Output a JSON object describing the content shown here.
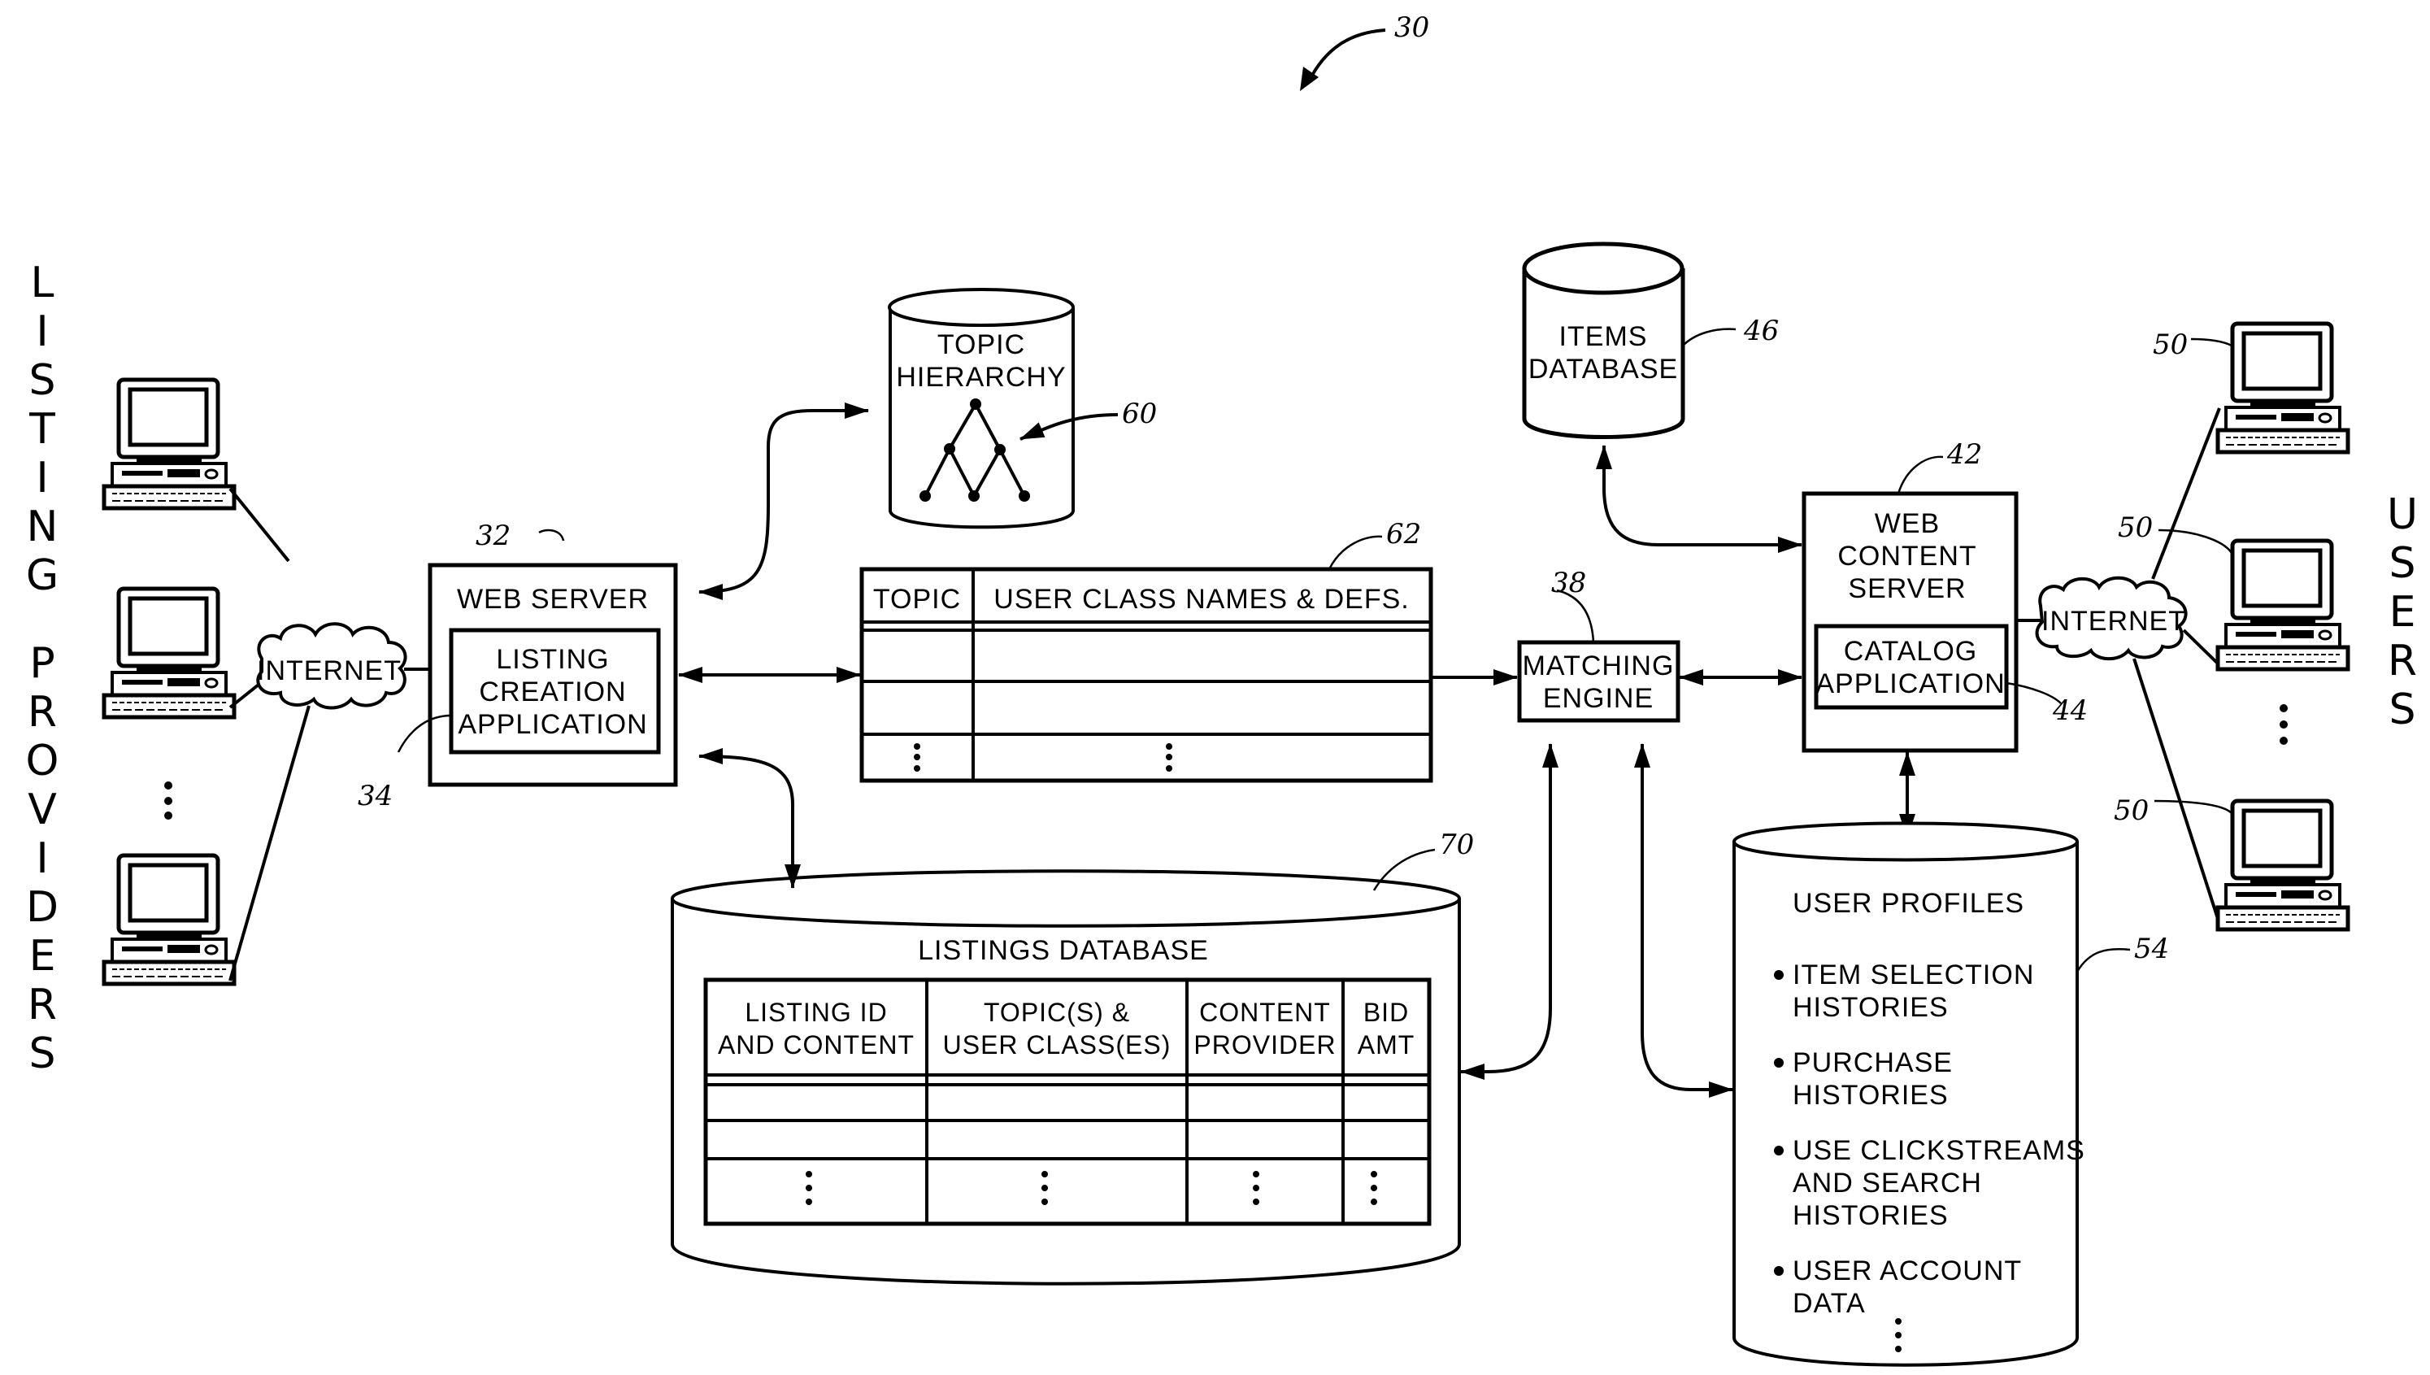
{
  "figure": {
    "reference_number": "30",
    "side_labels": {
      "left": "LISTING PROVIDERS",
      "right": "USERS"
    },
    "clouds": {
      "left": {
        "label": "INTERNET"
      },
      "right": {
        "label": "INTERNET"
      }
    },
    "web_server": {
      "title": "WEB SERVER",
      "ref": "32",
      "inner": {
        "lines": [
          "LISTING",
          "CREATION",
          "APPLICATION"
        ],
        "ref": "34"
      }
    },
    "topic_hierarchy": {
      "lines": [
        "TOPIC",
        "HIERARCHY"
      ],
      "ref": "60"
    },
    "topic_table": {
      "ref": "62",
      "headers": [
        "TOPIC",
        "USER CLASS NAMES & DEFS."
      ],
      "rows": [
        [
          "",
          ""
        ],
        [
          "",
          ""
        ],
        [
          "⋮",
          "⋮"
        ]
      ]
    },
    "matching_engine": {
      "lines": [
        "MATCHING",
        "ENGINE"
      ],
      "ref": "38"
    },
    "items_database": {
      "lines": [
        "ITEMS",
        "DATABASE"
      ],
      "ref": "46"
    },
    "web_content_server": {
      "lines": [
        "WEB",
        "CONTENT",
        "SERVER"
      ],
      "ref": "42",
      "inner": {
        "lines": [
          "CATALOG",
          "APPLICATION"
        ],
        "ref": "44"
      }
    },
    "listings_database": {
      "title": "LISTINGS DATABASE",
      "ref": "70",
      "headers": [
        [
          "LISTING ID",
          "AND CONTENT"
        ],
        [
          "TOPIC(S) &",
          "USER CLASS(ES)"
        ],
        [
          "CONTENT",
          "PROVIDER"
        ],
        [
          "BID",
          "AMT"
        ]
      ],
      "rows": [
        [
          "",
          "",
          "",
          ""
        ],
        [
          "",
          "",
          "",
          ""
        ],
        [
          "⋮",
          "⋮",
          "⋮",
          "⋮"
        ]
      ]
    },
    "user_profiles": {
      "title": "USER PROFILES",
      "ref": "54",
      "items": [
        [
          "ITEM SELECTION",
          "HISTORIES"
        ],
        [
          "PURCHASE",
          "HISTORIES"
        ],
        [
          "USE CLICKSTREAMS",
          "AND SEARCH",
          "HISTORIES"
        ],
        [
          "USER ACCOUNT",
          "DATA"
        ]
      ],
      "more": "⋮"
    },
    "user_computers": {
      "ref": "50",
      "count_shown": 3
    },
    "provider_computers": {
      "count_shown": 3
    },
    "ellipsis": "⋮"
  }
}
